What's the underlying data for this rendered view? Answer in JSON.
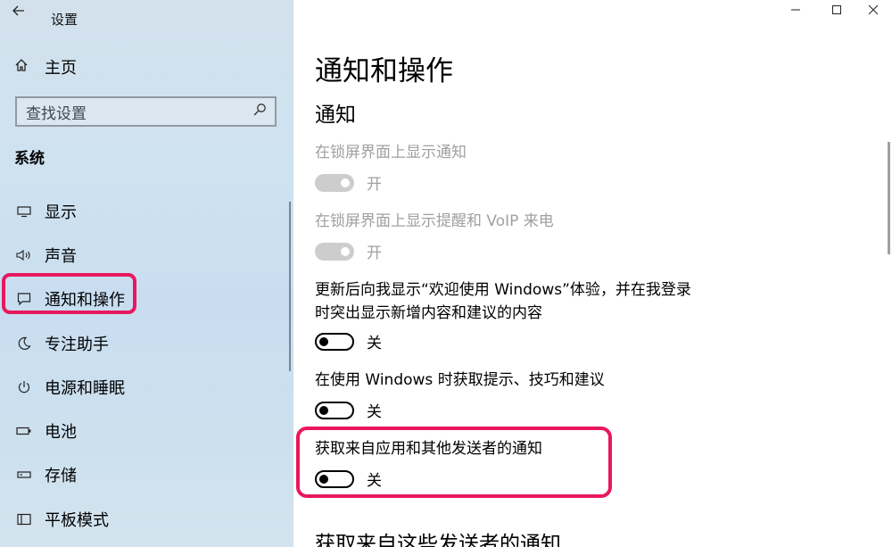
{
  "window": {
    "title": "设置",
    "controls": [
      "minimize-icon",
      "maximize-icon",
      "close-icon"
    ]
  },
  "sidebar": {
    "home_label": "主页",
    "search_placeholder": "查找设置",
    "section_heading": "系统",
    "items": [
      {
        "label": "显示",
        "icon": "monitor-icon"
      },
      {
        "label": "声音",
        "icon": "speaker-icon"
      },
      {
        "label": "通知和操作",
        "icon": "notification-icon",
        "selected": true
      },
      {
        "label": "专注助手",
        "icon": "moon-icon"
      },
      {
        "label": "电源和睡眠",
        "icon": "power-icon"
      },
      {
        "label": "电池",
        "icon": "battery-icon"
      },
      {
        "label": "存储",
        "icon": "storage-icon"
      },
      {
        "label": "平板模式",
        "icon": "tablet-icon"
      }
    ]
  },
  "main": {
    "page_title": "通知和操作",
    "section_title": "通知",
    "settings": [
      {
        "label": "在锁屏界面上显示通知",
        "state": "开",
        "enabled": false
      },
      {
        "label": "在锁屏界面上显示提醒和 VoIP 来电",
        "state": "开",
        "enabled": false
      },
      {
        "label_line1": "更新后向我显示“欢迎使用 Windows”体验，并在我登录",
        "label_line2": "时突出显示新增内容和建议的内容",
        "state": "关",
        "enabled": true
      },
      {
        "label": "在使用 Windows 时获取提示、技巧和建议",
        "state": "关",
        "enabled": true
      },
      {
        "label": "获取来自应用和其他发送者的通知",
        "state": "关",
        "enabled": true
      }
    ],
    "next_section_title": "获取来自这些发送者的通知"
  },
  "colors": {
    "highlight": "#e8185f",
    "sidebar_bg": "#cfe2f0",
    "disabled_text": "#a0a0a0"
  }
}
